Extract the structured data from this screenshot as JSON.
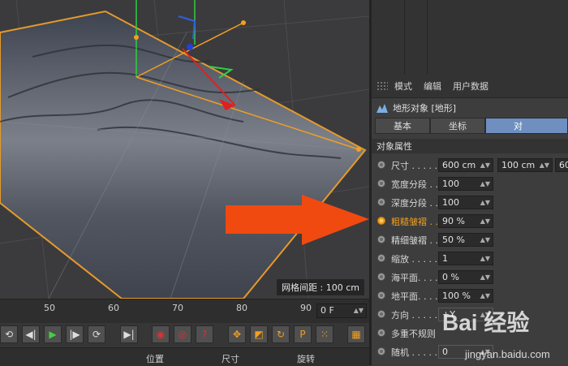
{
  "viewport": {
    "grid_spacing": "网格间距 : 100 cm"
  },
  "attributes_panel": {
    "menu": [
      "模式",
      "编辑",
      "用户数据"
    ],
    "object_title": "地形对象 [地形]",
    "tabs": [
      "基本",
      "坐标",
      "对"
    ],
    "section_title": "对象属性",
    "properties": [
      {
        "label": "尺寸 . . . . .",
        "values": [
          "600 cm",
          "100 cm",
          "60"
        ],
        "active": false
      },
      {
        "label": "宽度分段 . .",
        "values": [
          "100"
        ],
        "active": false
      },
      {
        "label": "深度分段 . .",
        "values": [
          "100"
        ],
        "active": false
      },
      {
        "label": "粗糙皱褶 . .",
        "values": [
          "90 %"
        ],
        "active": true
      },
      {
        "label": "精细皱褶 . .",
        "values": [
          "50 %"
        ],
        "active": false
      },
      {
        "label": "缩放 . . . . .",
        "values": [
          "1"
        ],
        "active": false
      },
      {
        "label": "海平面. . . .",
        "values": [
          "0 %"
        ],
        "active": false
      },
      {
        "label": "地平面. . . .",
        "values": [
          "100 %"
        ],
        "active": false
      },
      {
        "label": "方向 . . . . .",
        "values": [
          "+Y"
        ],
        "active": false
      },
      {
        "label": "多重不规则",
        "values": [],
        "active": false
      },
      {
        "label": "随机 . . . . .",
        "values": [
          "0"
        ],
        "active": false
      }
    ]
  },
  "timeline": {
    "ticks": [
      "50",
      "60",
      "70",
      "80",
      "90"
    ],
    "frame": "0 F"
  },
  "coord_bar": [
    "位置",
    "尺寸",
    "旋转"
  ],
  "watermark": {
    "brand": "Bai 经验",
    "url": "jingyan.baidu.com"
  },
  "colors": {
    "accent_orange": "#f0a020",
    "tab_active": "#6e8fc0",
    "arrow": "#f04a10"
  }
}
